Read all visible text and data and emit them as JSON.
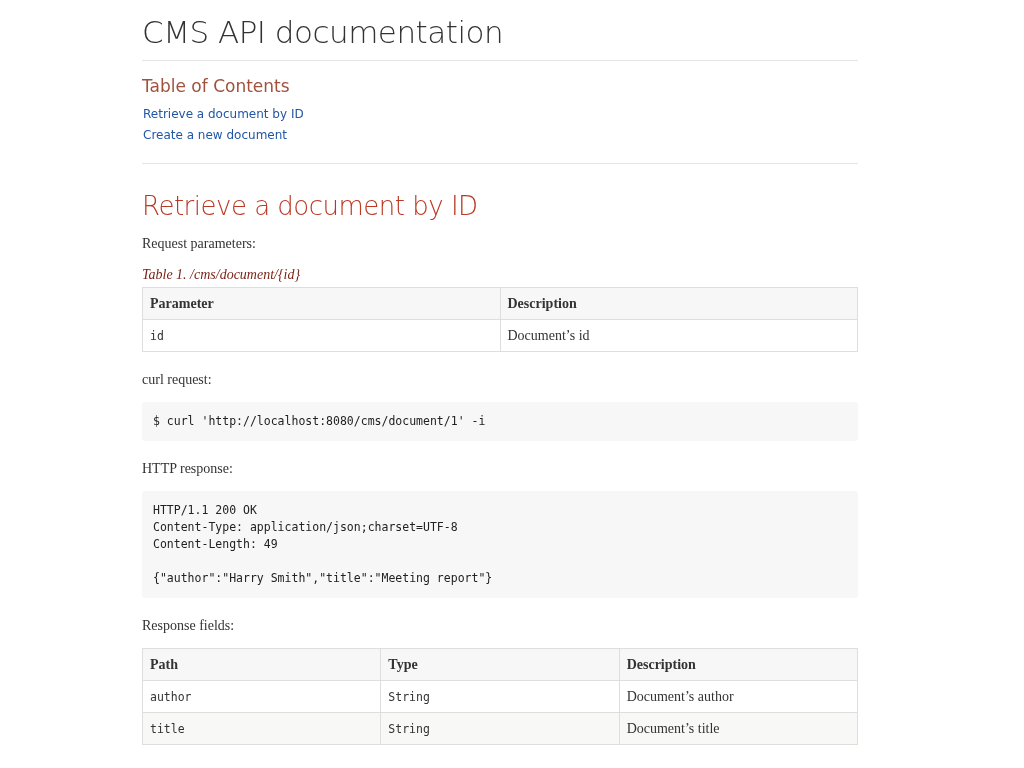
{
  "title": "CMS API documentation",
  "toc": {
    "title": "Table of Contents",
    "links": [
      "Retrieve a document by ID",
      "Create a new document"
    ]
  },
  "section": {
    "heading": "Retrieve a document by ID",
    "blocks": [
      {
        "kind": "para",
        "text": "Request parameters:"
      },
      {
        "kind": "table",
        "caption": "Table 1. /cms/document/{id}",
        "columns": [
          {
            "label": "Parameter",
            "kind": "code"
          },
          {
            "label": "Description",
            "kind": "text"
          }
        ],
        "rows": [
          [
            "id",
            "Document’s id"
          ]
        ]
      },
      {
        "kind": "para",
        "text": "curl request:"
      },
      {
        "kind": "code",
        "groups": [
          [
            "$ curl 'http://localhost:8080/cms/document/1' -i"
          ]
        ]
      },
      {
        "kind": "para",
        "text": "HTTP response:"
      },
      {
        "kind": "code",
        "groups": [
          [
            "HTTP/1.1 200 OK",
            "Content-Type: application/json;charset=UTF-8",
            "Content-Length: 49"
          ],
          [
            "{\"author\":\"Harry Smith\",\"title\":\"Meeting report\"}"
          ]
        ]
      },
      {
        "kind": "para",
        "text": "Response fields:"
      },
      {
        "kind": "table",
        "columns": [
          {
            "label": "Path",
            "kind": "code"
          },
          {
            "label": "Type",
            "kind": "code"
          },
          {
            "label": "Description",
            "kind": "text"
          }
        ],
        "rows": [
          [
            "author",
            "String",
            "Document’s author"
          ],
          [
            "title",
            "String",
            "Document’s title"
          ]
        ]
      }
    ]
  }
}
